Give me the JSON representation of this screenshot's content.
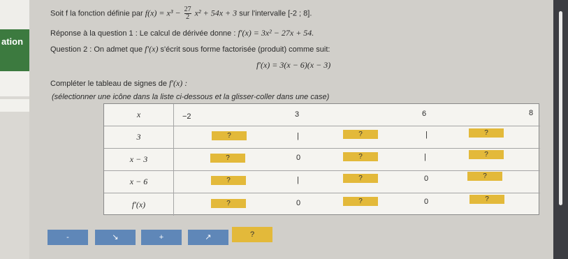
{
  "sidebar": {
    "label": "ation"
  },
  "intro": {
    "lead": "Soit f la fonction définie par",
    "formula_left": "f(x) = x³ −",
    "frac_num": "27",
    "frac_den": "2",
    "formula_right": "x² + 54x + 3",
    "interval_text": "sur l'intervalle [-2 ; 8]."
  },
  "answer1": {
    "text": "Réponse à la question 1 : Le calcul de dérivée donne :",
    "formula": "f′(x) = 3x² − 27x + 54."
  },
  "question2": {
    "lead": "Question 2 : On admet que",
    "fprime": "f′(x)",
    "rest": "s'écrit sous forme factorisée (produit) comme suit:",
    "factored": "f′(x) = 3(x − 6)(x − 3)"
  },
  "instruction": {
    "text": "Compléter le tableau de signes de",
    "fprime": "f′(x) :"
  },
  "hint": "(sélectionner une icône dans la liste ci-dessous et la glisser-coller dans une case)",
  "table": {
    "header": {
      "label": "x",
      "values": [
        "−2",
        "3",
        "6",
        "8"
      ]
    },
    "rows": [
      {
        "label": "3",
        "cells": [
          "?",
          "|",
          "?",
          "|",
          "?"
        ]
      },
      {
        "label": "x − 3",
        "cells": [
          "?",
          "0",
          "?",
          "|",
          "?"
        ]
      },
      {
        "label": "x − 6",
        "cells": [
          "?",
          "|",
          "?",
          "0",
          "?"
        ]
      },
      {
        "label": "f′(x)",
        "cells": [
          "?",
          "0",
          "?",
          "0",
          "?"
        ]
      }
    ]
  },
  "palette": [
    "-",
    "↘",
    "+",
    "↗",
    "?"
  ],
  "colors": {
    "slot": "#e3b93a",
    "palette": "#5f87b8",
    "sidebar_green": "#3c7a3f"
  }
}
